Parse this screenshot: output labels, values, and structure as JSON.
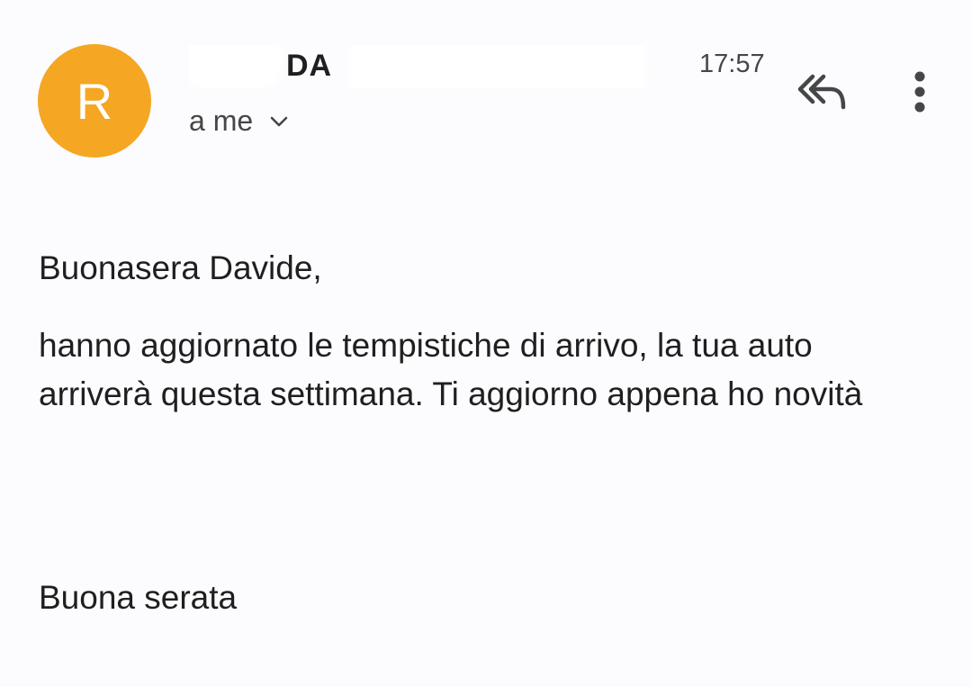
{
  "header": {
    "avatar_letter": "R",
    "avatar_color": "#f5a623",
    "sender_name": "DA",
    "time": "17:57",
    "recipient": "a me",
    "expand_icon": "chevron-down-icon",
    "reply_all_icon": "reply-all-icon",
    "more_icon": "more-vert-icon"
  },
  "message": {
    "greeting": "Buonasera Davide,",
    "body": "hanno aggiornato le tempistiche di arrivo, la tua auto arriverà questa settimana. Ti aggiorno appena ho novità",
    "closing": "Buona serata"
  }
}
